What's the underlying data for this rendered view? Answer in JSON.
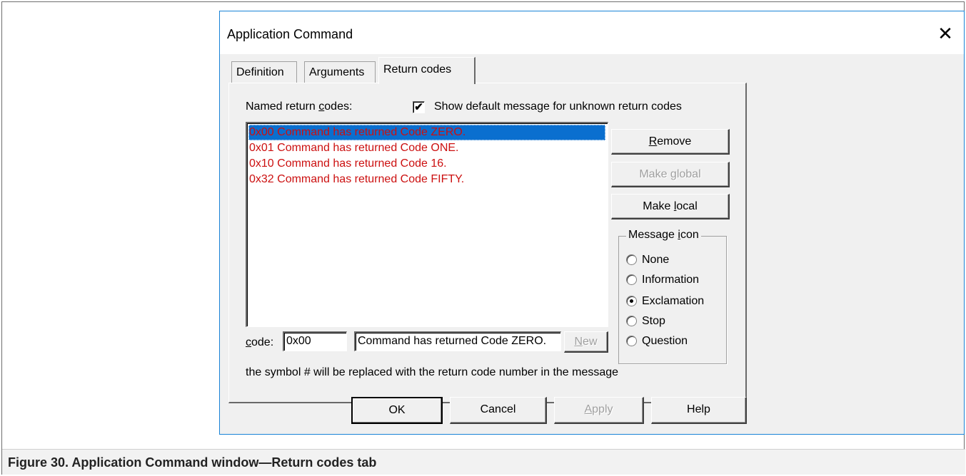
{
  "window": {
    "title": "Application Command",
    "close_glyph": "✕"
  },
  "tabs": [
    {
      "label": "Definition",
      "active": false
    },
    {
      "label": "Arguments",
      "active": false
    },
    {
      "label": "Return codes",
      "active": true
    }
  ],
  "panel": {
    "named_label_pre": "Named return ",
    "named_label_mnemonic": "c",
    "named_label_post": "odes:",
    "show_default_checkbox": {
      "label": "Show default message for unknown return codes",
      "checked": true,
      "check_glyph": "✔"
    },
    "return_codes": [
      {
        "text": "0x00 Command has returned Code ZERO.",
        "selected": true
      },
      {
        "text": "0x01 Command has returned Code ONE.",
        "selected": false
      },
      {
        "text": "0x10 Command has returned Code 16.",
        "selected": false
      },
      {
        "text": "0x32 Command has returned Code FIFTY.",
        "selected": false
      }
    ],
    "buttons": {
      "remove_mnemonic": "R",
      "remove_rest": "emove",
      "make_global_pre": "Make ",
      "make_global_mnemonic": "g",
      "make_global_post": "lobal",
      "make_local_pre": "Make ",
      "make_local_mnemonic": "l",
      "make_local_post": "ocal",
      "new_mnemonic": "N",
      "new_rest": "ew"
    },
    "message_icon": {
      "title_pre": "Message ",
      "title_mnemonic": "i",
      "title_post": "con",
      "options": [
        {
          "label": "None",
          "checked": false
        },
        {
          "label": "Information",
          "checked": false
        },
        {
          "label": "Exclamation",
          "checked": true
        },
        {
          "label": "Stop",
          "checked": false
        },
        {
          "label": "Question",
          "checked": false
        }
      ]
    },
    "code_label_mnemonic": "c",
    "code_label_rest": "ode:",
    "code_value": "0x00",
    "message_value": "Command has returned Code ZERO.",
    "hint": "the symbol # will be replaced with the return code number in the message"
  },
  "footer": {
    "ok": "OK",
    "cancel": "Cancel",
    "apply_mnemonic": "A",
    "apply_rest": "pply",
    "help": "Help"
  },
  "caption": "Figure 30. Application Command window—Return codes tab"
}
